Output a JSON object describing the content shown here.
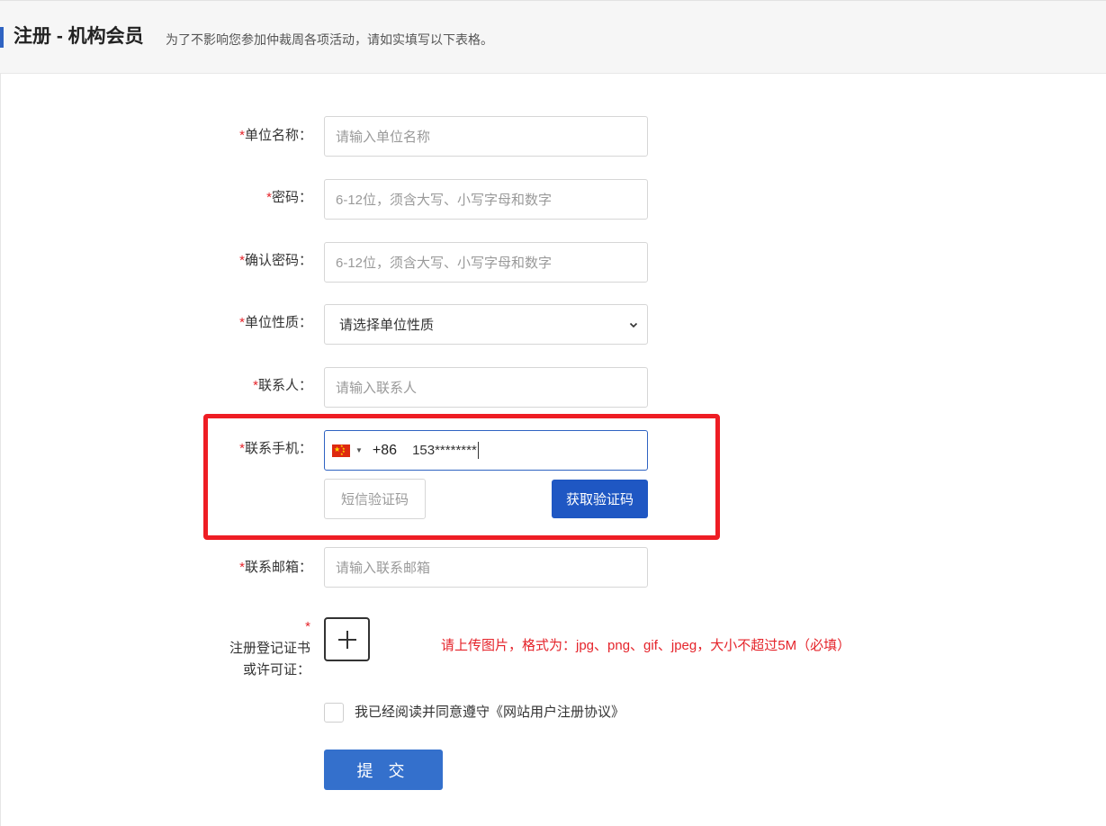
{
  "header": {
    "title": "注册 - 机构会员",
    "subtitle": "为了不影响您参加仲裁周各项活动，请如实填写以下表格。"
  },
  "form": {
    "required_mark": "*",
    "unit_name": {
      "label": "单位名称：",
      "placeholder": "请输入单位名称"
    },
    "password": {
      "label": "密码：",
      "placeholder": "6-12位，须含大写、小写字母和数字"
    },
    "confirm_password": {
      "label": "确认密码：",
      "placeholder": "6-12位，须含大写、小写字母和数字"
    },
    "unit_type": {
      "label": "单位性质：",
      "selected": "请选择单位性质"
    },
    "contact": {
      "label": "联系人：",
      "placeholder": "请输入联系人"
    },
    "phone": {
      "label": "联系手机：",
      "dial_code": "+86",
      "value": "153********"
    },
    "sms_code": {
      "placeholder": "短信验证码"
    },
    "get_code_button": "获取验证码",
    "email": {
      "label": "联系邮箱：",
      "placeholder": "请输入联系邮箱"
    },
    "certificate": {
      "label_line1": "注册登记证书",
      "label_line2": "或许可证：",
      "hint": "请上传图片，格式为：jpg、png、gif、jpeg，大小不超过5M（必填）"
    },
    "agreement": "我已经阅读并同意遵守《网站用户注册协议》",
    "submit": "提 交"
  },
  "colors": {
    "accent": "#1f57c3",
    "required": "#e5242b",
    "highlight": "#ee1d24"
  },
  "icons": {
    "upload": "plus-icon",
    "select": "chevron-down-icon",
    "flag": "china-flag-icon"
  }
}
